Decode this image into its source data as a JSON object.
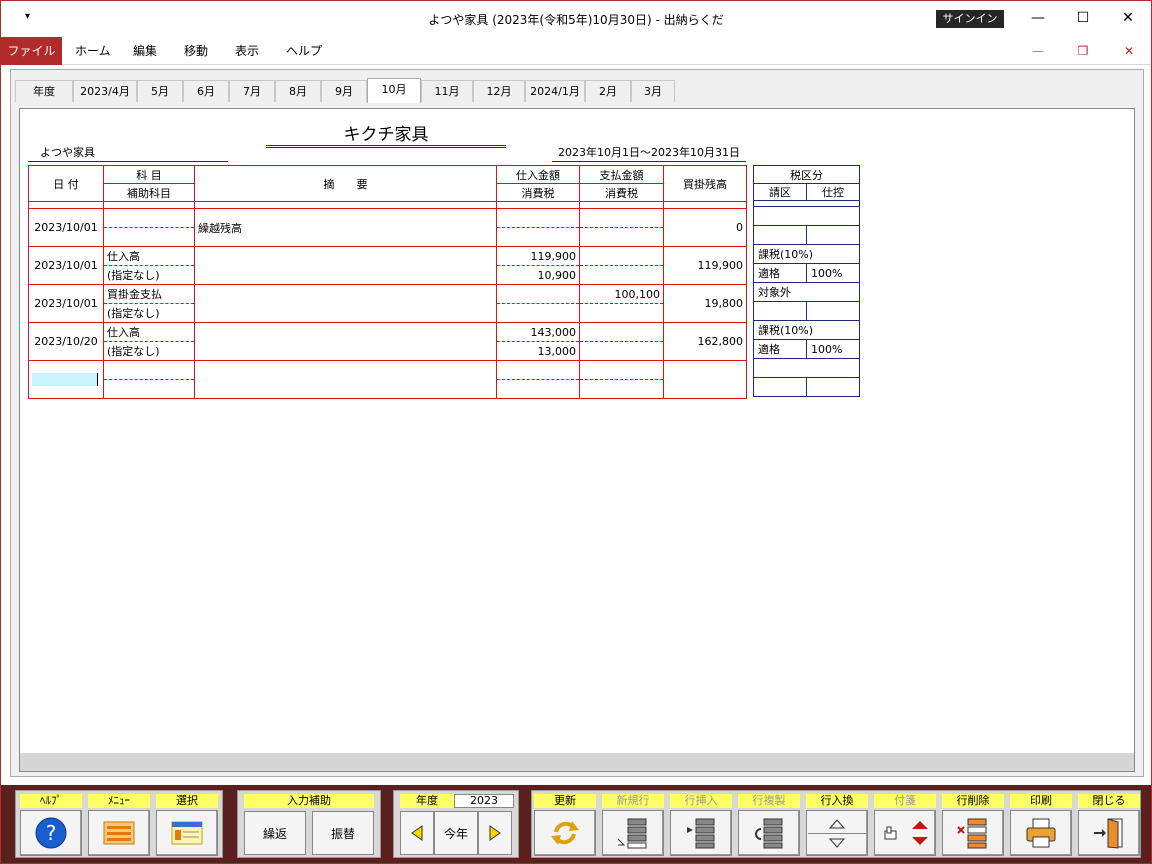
{
  "window": {
    "title": "よつや家具 (2023年(令和5年)10月30日)  -  出納らくだ",
    "qat_icon": "▾",
    "signin": "サインイン"
  },
  "menu": {
    "file": "ファイル",
    "items": [
      "ホーム",
      "編集",
      "移動",
      "表示",
      "ヘルプ"
    ]
  },
  "tabs": [
    "年度",
    "2023/4月",
    "5月",
    "6月",
    "7月",
    "8月",
    "9月",
    "10月",
    "11月",
    "12月",
    "2024/1月",
    "2月",
    "3月"
  ],
  "active_tab": "10月",
  "report": {
    "shop_name": "キクチ家具",
    "company": "よつや家具",
    "period": "2023年10月1日～2023年10月31日"
  },
  "headers": {
    "date": "日 付",
    "account": "科 目",
    "sub_account": "補助科目",
    "description": "摘　　要",
    "purchase": "仕入金額",
    "purchase_tax": "消費税",
    "payment": "支払金額",
    "payment_tax": "消費税",
    "balance": "買掛残高",
    "tax_class": "税区分",
    "tax_invoice": "請区",
    "tax_deduct": "仕控"
  },
  "rows": [
    {
      "date": "2023/10/01",
      "account": "",
      "sub": "",
      "desc": "繰越残高",
      "purchase": "",
      "purchase_tax": "",
      "payment": "",
      "payment_tax": "",
      "balance": "0",
      "tax": "",
      "invoice": "",
      "deduct": ""
    },
    {
      "date": "2023/10/01",
      "account": "仕入高",
      "sub": "(指定なし)",
      "desc": "",
      "purchase": "119,900",
      "purchase_tax": "10,900",
      "payment": "",
      "payment_tax": "",
      "balance": "119,900",
      "tax": "課税(10%)",
      "invoice": "適格",
      "deduct": "100%"
    },
    {
      "date": "2023/10/01",
      "account": "買掛金支払",
      "sub": "(指定なし)",
      "desc": "",
      "purchase": "",
      "purchase_tax": "",
      "payment": "100,100",
      "payment_tax": "",
      "balance": "19,800",
      "tax": "対象外",
      "invoice": "",
      "deduct": ""
    },
    {
      "date": "2023/10/20",
      "account": "仕入高",
      "sub": "(指定なし)",
      "desc": "",
      "purchase": "143,000",
      "purchase_tax": "13,000",
      "payment": "",
      "payment_tax": "",
      "balance": "162,800",
      "tax": "課税(10%)",
      "invoice": "適格",
      "deduct": "100%"
    }
  ],
  "toolbar": {
    "help": "ﾍﾙﾌﾟ",
    "menu": "ﾒﾆｭｰ",
    "select": "選択",
    "input_assist": "入力補助",
    "repeat": "繰返",
    "transfer": "振替",
    "year_label": "年度",
    "year_value": "2023",
    "this_year": "今年",
    "refresh": "更新",
    "new_row": "新規行",
    "insert_row": "行挿入",
    "copy_row": "行複製",
    "swap_row": "行入換",
    "tag": "付箋",
    "delete_row": "行削除",
    "print": "印刷",
    "close": "閉じる"
  },
  "colors": {
    "accent": "#b22b2b",
    "toolbar_bg": "#5a1f1f",
    "label_yellow": "#ffff66",
    "ledger_red": "#dd1111",
    "navy": "#1f2b7a"
  }
}
